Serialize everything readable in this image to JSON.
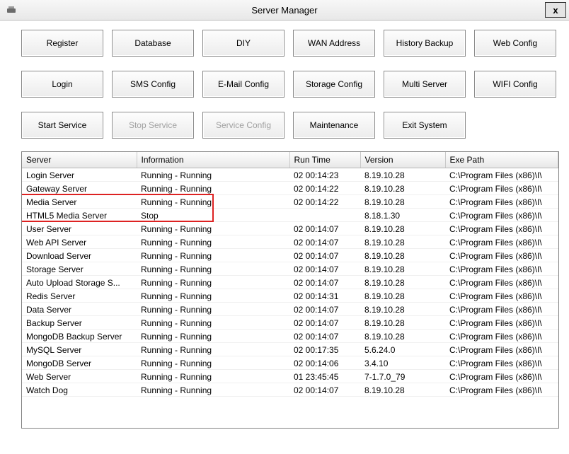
{
  "window": {
    "title": "Server Manager",
    "close": "x"
  },
  "buttons": {
    "row1": [
      "Register",
      "Database",
      "DIY",
      "WAN Address",
      "History Backup",
      "Web Config"
    ],
    "row2": [
      "Login",
      "SMS Config",
      "E-Mail Config",
      "Storage Config",
      "Multi Server",
      "WIFI Config"
    ],
    "row3": [
      "Start Service",
      "Stop Service",
      "Service Config",
      "Maintenance",
      "Exit System",
      ""
    ]
  },
  "disabled_buttons": [
    "Stop Service",
    "Service Config"
  ],
  "table": {
    "columns": [
      "Server",
      "Information",
      "Run Time",
      "Version",
      "Exe Path"
    ],
    "rows": [
      {
        "server": "Login Server",
        "info": "Running - Running",
        "time": "02 00:14:23",
        "version": "8.19.10.28",
        "path": "C:\\Program Files (x86)\\I\\"
      },
      {
        "server": "Gateway Server",
        "info": "Running - Running",
        "time": "02 00:14:22",
        "version": "8.19.10.28",
        "path": "C:\\Program Files (x86)\\I\\"
      },
      {
        "server": "Media Server",
        "info": "Running - Running",
        "time": "02 00:14:22",
        "version": "8.19.10.28",
        "path": "C:\\Program Files (x86)\\I\\"
      },
      {
        "server": "HTML5 Media Server",
        "info": "Stop",
        "time": "",
        "version": "8.18.1.30",
        "path": "C:\\Program Files (x86)\\I\\"
      },
      {
        "server": "User Server",
        "info": "Running - Running",
        "time": "02 00:14:07",
        "version": "8.19.10.28",
        "path": "C:\\Program Files (x86)\\I\\"
      },
      {
        "server": "Web API Server",
        "info": "Running - Running",
        "time": "02 00:14:07",
        "version": "8.19.10.28",
        "path": "C:\\Program Files (x86)\\I\\"
      },
      {
        "server": "Download Server",
        "info": "Running - Running",
        "time": "02 00:14:07",
        "version": "8.19.10.28",
        "path": "C:\\Program Files (x86)\\I\\"
      },
      {
        "server": "Storage Server",
        "info": "Running - Running",
        "time": "02 00:14:07",
        "version": "8.19.10.28",
        "path": "C:\\Program Files (x86)\\I\\"
      },
      {
        "server": "Auto Upload Storage S...",
        "info": "Running - Running",
        "time": "02 00:14:07",
        "version": "8.19.10.28",
        "path": "C:\\Program Files (x86)\\I\\"
      },
      {
        "server": "Redis Server",
        "info": "Running - Running",
        "time": "02 00:14:31",
        "version": "8.19.10.28",
        "path": "C:\\Program Files (x86)\\I\\"
      },
      {
        "server": "Data Server",
        "info": "Running - Running",
        "time": "02 00:14:07",
        "version": "8.19.10.28",
        "path": "C:\\Program Files (x86)\\I\\"
      },
      {
        "server": "Backup Server",
        "info": "Running - Running",
        "time": "02 00:14:07",
        "version": "8.19.10.28",
        "path": "C:\\Program Files (x86)\\I\\"
      },
      {
        "server": "MongoDB Backup Server",
        "info": "Running - Running",
        "time": "02 00:14:07",
        "version": "8.19.10.28",
        "path": "C:\\Program Files (x86)\\I\\"
      },
      {
        "server": "MySQL Server",
        "info": "Running - Running",
        "time": "02 00:17:35",
        "version": "5.6.24.0",
        "path": "C:\\Program Files (x86)\\I\\"
      },
      {
        "server": "MongoDB Server",
        "info": "Running - Running",
        "time": "02 00:14:06",
        "version": "3.4.10",
        "path": "C:\\Program Files (x86)\\I\\"
      },
      {
        "server": "Web Server",
        "info": "Running - Running",
        "time": "01 23:45:45",
        "version": "7-1.7.0_79",
        "path": "C:\\Program Files (x86)\\I\\"
      },
      {
        "server": "Watch Dog",
        "info": "Running - Running",
        "time": "02 00:14:07",
        "version": "8.19.10.28",
        "path": "C:\\Program Files (x86)\\I\\"
      }
    ]
  }
}
